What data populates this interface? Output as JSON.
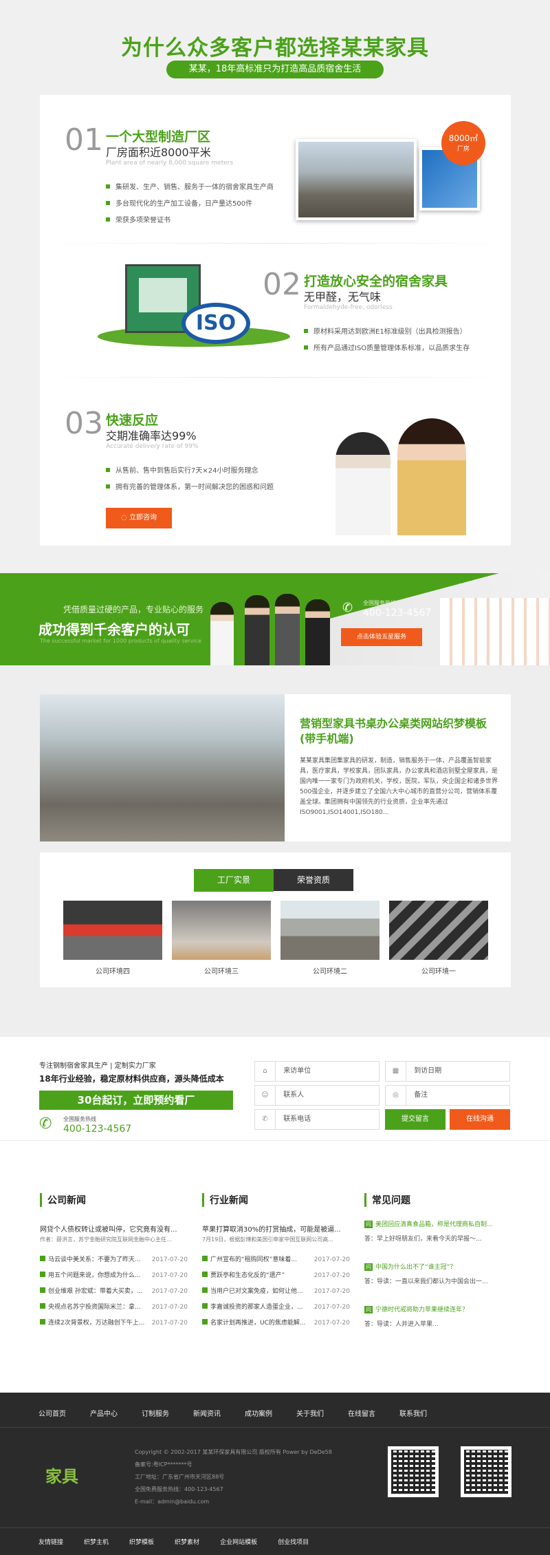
{
  "header": {
    "title": "为什么众多客户都选择某某家具",
    "pill": "某某，18年高标准只为打造高品质宿舍生活"
  },
  "features": [
    {
      "num": "01",
      "title": "一个大型制造厂区",
      "sub": "厂房面积近8000平米",
      "en": "Plant area of nearly 8,000 square meters",
      "bullets": [
        "集研发、生产、销售、服务于一体的宿舍家具生产商",
        "多台现代化的生产加工设备，日产量达500件",
        "荣获多项荣誉证书"
      ],
      "badge_num": "8000㎡",
      "badge_text": "厂房"
    },
    {
      "num": "02",
      "title": "打造放心安全的宿舍家具",
      "sub": "无甲醛，无气味",
      "en": "Formaldehyde-free, odorless",
      "bullets": [
        "原材料采用达到欧洲E1标准级别（出具检测报告）",
        "所有产品通过ISO质量管理体系标准，以品质求生存"
      ],
      "iso": "ISO"
    },
    {
      "num": "03",
      "title": "快速反应",
      "sub": "交期准确率达99%",
      "en": "Accurate delivery rate of 99%",
      "bullets": [
        "从售前、售中到售后实行7天×24小时服务理念",
        "拥有完善的管理体系，第一时间解决您的困惑和问题"
      ],
      "button": "立即咨询"
    }
  ],
  "banner": {
    "line1": "凭借质量过硬的产品，专业贴心的服务",
    "line2": "成功得到千余客户的认可",
    "en": "The successful market for 1000 products of quality service",
    "hotline_label": "全国服务热线",
    "hotline": "400-123-4567",
    "button": "点击体验五星服务"
  },
  "about": {
    "title": "营销型家具书桌办公桌类网站织梦模板(带手机端)",
    "body": "某某家具集团集家具的研发，制造，销售服务于一体，产品覆盖智能家具，医疗家具，学校家具，团队家具，办公家具和酒店别墅全屋家具，是国内唯一一家专门为政府机关，学校，医院，军队，央企国企和诸多世界500强企业，并逐步建立了全国六大中心城市的直营分公司，营销体系覆盖全球。集团拥有中国领先的行业资质，企业率先通过ISO9001,ISO14001,ISO180..."
  },
  "gallery": {
    "tabs": [
      "工厂实景",
      "荣誉资质"
    ],
    "items": [
      "公司环境四",
      "公司环境三",
      "公司环境二",
      "公司环境一"
    ]
  },
  "contact": {
    "line1": "专注钢制宿舍家具生产 | 定制实力厂家",
    "line2": "18年行业经验，稳定原材料供应商，源头降低成本",
    "cta": "30台起订，立即预约看厂",
    "hotline_label": "全国服务热线",
    "hotline": "400-123-4567",
    "fields": {
      "company": "来访单位",
      "date": "到访日期",
      "contact": "联系人",
      "remark": "备注",
      "phone": "联系电话"
    },
    "submit": "提交留言",
    "online": "在线沟通"
  },
  "news": {
    "company": {
      "heading": "公司新闻",
      "lead_title": "网贷个人债权转让或被叫停，它究竟有没有...",
      "lead_meta": "作者：薛洪言，苏宁金融研究院互联网金融中心主任...",
      "items": [
        {
          "t": "马云谈中美关系：不要为了昨天...",
          "d": "2017-07-20"
        },
        {
          "t": "用五个问题来说，你想成为什么...",
          "d": "2017-07-20"
        },
        {
          "t": "创业维艰 孙宏斌：带着大买卖，...",
          "d": "2017-07-20"
        },
        {
          "t": "央视点名苏宁投资国际米兰：拿...",
          "d": "2017-07-20"
        },
        {
          "t": "连续2次背景权，万达融创下午上...",
          "d": "2017-07-20"
        }
      ]
    },
    "industry": {
      "heading": "行业新闻",
      "lead_title": "苹果打算取消30%的打赏抽成，可能是被逼...",
      "lead_meta": "7月19日，根据彭博和美国引申家中国互联网公司高...",
      "items": [
        {
          "t": "广州宣布的“租购同权”意味着...",
          "d": "2017-07-20"
        },
        {
          "t": "贾跃亭和生态化反的“遗产”",
          "d": "2017-07-20"
        },
        {
          "t": "当用户已对文案免疫，如何让他...",
          "d": "2017-07-20"
        },
        {
          "t": "李嘉诚投资的那家人造蛋企业，...",
          "d": "2017-07-20"
        },
        {
          "t": "名家计划再推进，UC的焦虑能解...",
          "d": "2017-07-20"
        }
      ]
    },
    "faq": {
      "heading": "常见问题",
      "items": [
        {
          "q": "美团回应清真食品箱，称是代理商私自制...",
          "a": "答：早上好呀朋友们，来看今天的早报～..."
        },
        {
          "q": "中国为什么出不了“谁主冠”？",
          "a": "答：导读：一直以来我们都认为中国会出一..."
        },
        {
          "q": "宁德时代戒将助力苹果继续连年？",
          "a": "答：导读：人并进入苹果..."
        }
      ],
      "q_mark": "问"
    }
  },
  "footer": {
    "nav": [
      "公司首页",
      "产品中心",
      "订制服务",
      "新闻资讯",
      "成功案例",
      "关于我们",
      "在线留言",
      "联系我们"
    ],
    "logo": "家具",
    "info": [
      "Copyright © 2002-2017 某某环保家具有限公司 版权所有 Power by DeDe58",
      "备案号:粤ICP*******号",
      "工厂地址：广东省广州市天河区88号",
      "全国免费服务热线：400-123-4567",
      "E-mail：admin@baidu.com"
    ],
    "links_label": "友情链接",
    "links": [
      "织梦主机",
      "织梦模板",
      "织梦素材",
      "企业网站模板",
      "创业找项目"
    ]
  },
  "colors": {
    "accent": "#4ba21a",
    "orange": "#f05a1a",
    "footer_bg": "#2b2b2b"
  }
}
